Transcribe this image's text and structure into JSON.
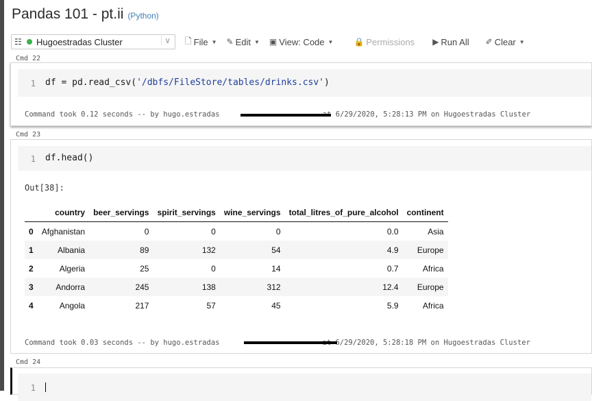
{
  "notebook": {
    "title": "Pandas 101 - pt.ii",
    "language": "(Python)"
  },
  "toolbar": {
    "cluster_name": "Hugoestradas Cluster",
    "file": "File",
    "edit": "Edit",
    "view": "View: Code",
    "permissions": "Permissions",
    "run_all": "Run All",
    "clear": "Clear"
  },
  "cells": {
    "c22": {
      "label": "Cmd 22",
      "line_number": "1",
      "code_prefix": "df = pd.read_csv(",
      "code_string": "'/dbfs/FileStore/tables/drinks.csv'",
      "code_suffix": ")",
      "info_prefix": "Command took 0.12 seconds -- by hugo.estradas",
      "info_suffix": " at 6/29/2020, 5:28:13 PM on Hugoestradas Cluster"
    },
    "c23": {
      "label": "Cmd 23",
      "line_number": "1",
      "code": "df.head()",
      "out_label": "Out[38]:",
      "info_prefix": "Command took 0.03 seconds -- by hugo.estradas",
      "info_suffix": "at 6/29/2020, 5:28:18 PM on Hugoestradas Cluster"
    },
    "c24": {
      "label": "Cmd 24",
      "line_number": "1"
    }
  },
  "dataframe": {
    "columns": [
      "",
      "country",
      "beer_servings",
      "spirit_servings",
      "wine_servings",
      "total_litres_of_pure_alcohol",
      "continent"
    ],
    "rows": [
      [
        "0",
        "Afghanistan",
        "0",
        "0",
        "0",
        "0.0",
        "Asia"
      ],
      [
        "1",
        "Albania",
        "89",
        "132",
        "54",
        "4.9",
        "Europe"
      ],
      [
        "2",
        "Algeria",
        "25",
        "0",
        "14",
        "0.7",
        "Africa"
      ],
      [
        "3",
        "Andorra",
        "245",
        "138",
        "312",
        "12.4",
        "Europe"
      ],
      [
        "4",
        "Angola",
        "217",
        "57",
        "45",
        "5.9",
        "Africa"
      ]
    ]
  }
}
